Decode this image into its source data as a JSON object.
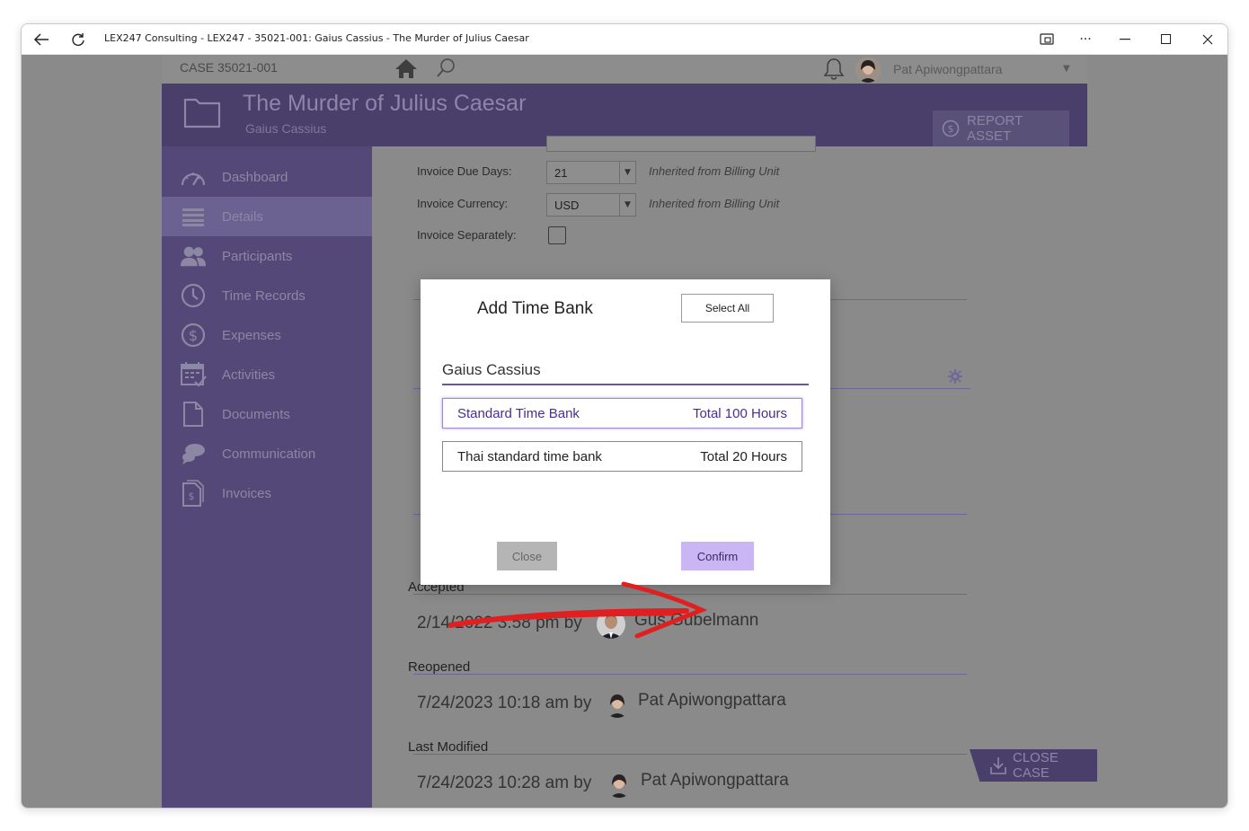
{
  "window": {
    "title": "LEX247 Consulting - LEX247 - 35021-001: Gaius Cassius - The Murder of Julius Caesar"
  },
  "topbar": {
    "case_label": "CASE   35021-001",
    "user_name": "Pat Apiwongpattara"
  },
  "header": {
    "title": "The Murder of Julius Caesar",
    "subtitle": "Gaius Cassius",
    "report_asset": "REPORT ASSET"
  },
  "sidebar": {
    "items": [
      {
        "label": "Dashboard",
        "icon": "gauge-icon"
      },
      {
        "label": "Details",
        "icon": "list-icon",
        "active": true
      },
      {
        "label": "Participants",
        "icon": "people-icon"
      },
      {
        "label": "Time Records",
        "icon": "clock-icon"
      },
      {
        "label": "Expenses",
        "icon": "dollar-icon"
      },
      {
        "label": "Activities",
        "icon": "calendar-icon"
      },
      {
        "label": "Documents",
        "icon": "document-icon"
      },
      {
        "label": "Communication",
        "icon": "chat-icon"
      },
      {
        "label": "Invoices",
        "icon": "invoice-icon"
      }
    ]
  },
  "billing": {
    "due_days_label": "Invoice Due Days:",
    "due_days_value": "21",
    "due_days_note": "Inherited from Billing Unit",
    "currency_label": "Invoice Currency:",
    "currency_value": "USD",
    "currency_note": "Inherited from Billing Unit",
    "separately_label": "Invoice Separately:"
  },
  "history": {
    "accepted_label": "Accepted",
    "accepted_when": "2/14/2022 3:58 pm by",
    "accepted_by": "Gus Gubelmann",
    "reopened_label": "Reopened",
    "reopened_when": "7/24/2023 10:18 am by",
    "reopened_by": "Pat Apiwongpattara",
    "modified_label": "Last Modified",
    "modified_when": "7/24/2023 10:28 am by",
    "modified_by": "Pat Apiwongpattara"
  },
  "close_case": "CLOSE CASE",
  "modal": {
    "title": "Add Time Bank",
    "select_all": "Select All",
    "person": "Gaius Cassius",
    "banks": [
      {
        "name": "Standard Time Bank",
        "total": "Total 100 Hours"
      },
      {
        "name": "Thai standard time bank",
        "total": "Total 20 Hours"
      }
    ],
    "close": "Close",
    "confirm": "Confirm"
  },
  "colors": {
    "sidebar": "#544878",
    "header": "#4a3e6b",
    "confirm_bg": "#c9b6f2",
    "annotation_arrow": "#e02020"
  }
}
